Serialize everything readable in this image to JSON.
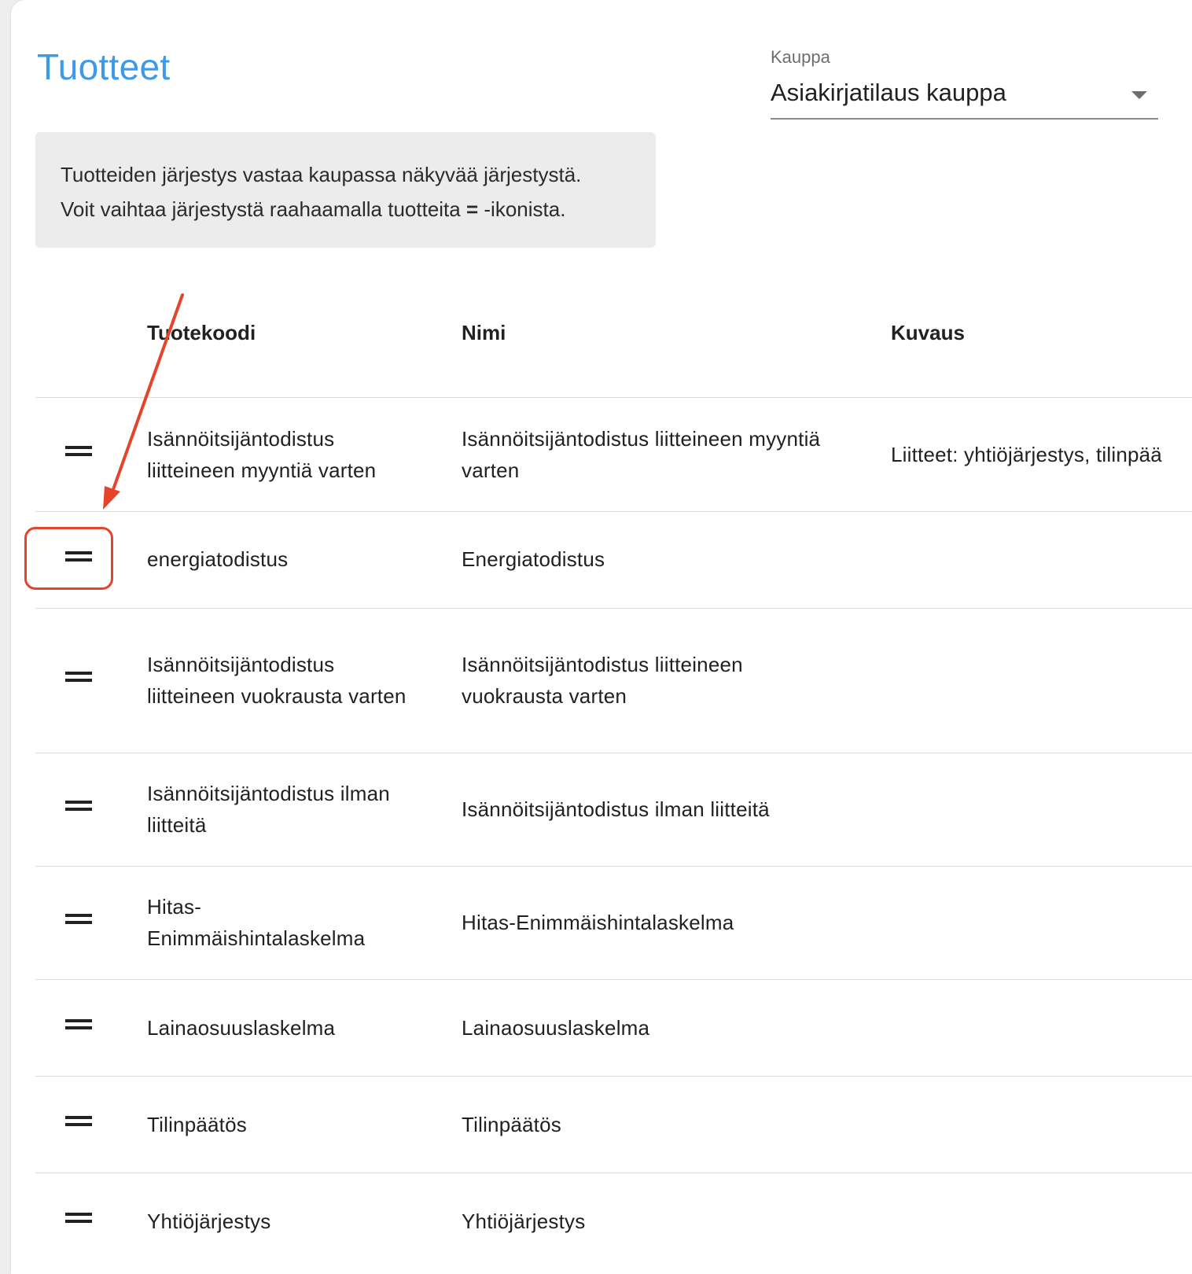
{
  "page": {
    "title": "Tuotteet",
    "store_label": "Kauppa",
    "store_value": "Asiakirjatilaus kauppa"
  },
  "info": {
    "line1": "Tuotteiden järjestys vastaa kaupassa näkyvää järjestystä.",
    "line2_before": "Voit vaihtaa järjestystä raahaamalla tuotteita ",
    "line2_glyph": "=",
    "line2_after": " -ikonista."
  },
  "table": {
    "headers": [
      "Tuotekoodi",
      "Nimi",
      "Kuvaus"
    ],
    "rows": [
      {
        "code": "Isännöitsijäntodistus liitteineen myyntiä varten",
        "name": "Isännöitsijäntodistus liitteineen myyntiä varten",
        "desc": "Liitteet: yhtiöjärjestys, tilinpää"
      },
      {
        "code": "energiatodistus",
        "name": "Energiatodistus",
        "desc": ""
      },
      {
        "code": "Isännöitsijäntodistus liitteineen vuokrausta varten",
        "name": "Isännöitsijäntodistus liitteineen vuokrausta varten",
        "desc": ""
      },
      {
        "code": "Isännöitsijäntodistus ilman liitteitä",
        "name": "Isännöitsijäntodistus ilman liitteitä",
        "desc": ""
      },
      {
        "code": "Hitas-Enimmäishintalaskelma",
        "name": "Hitas-Enimmäishintalaskelma",
        "desc": ""
      },
      {
        "code": "Lainaosuuslaskelma",
        "name": "Lainaosuuslaskelma",
        "desc": ""
      },
      {
        "code": "Tilinpäätös",
        "name": "Tilinpäätös",
        "desc": ""
      },
      {
        "code": "Yhtiöjärjestys",
        "name": "Yhtiöjärjestys",
        "desc": ""
      }
    ]
  },
  "annotation": {
    "color": "#e5432a"
  }
}
